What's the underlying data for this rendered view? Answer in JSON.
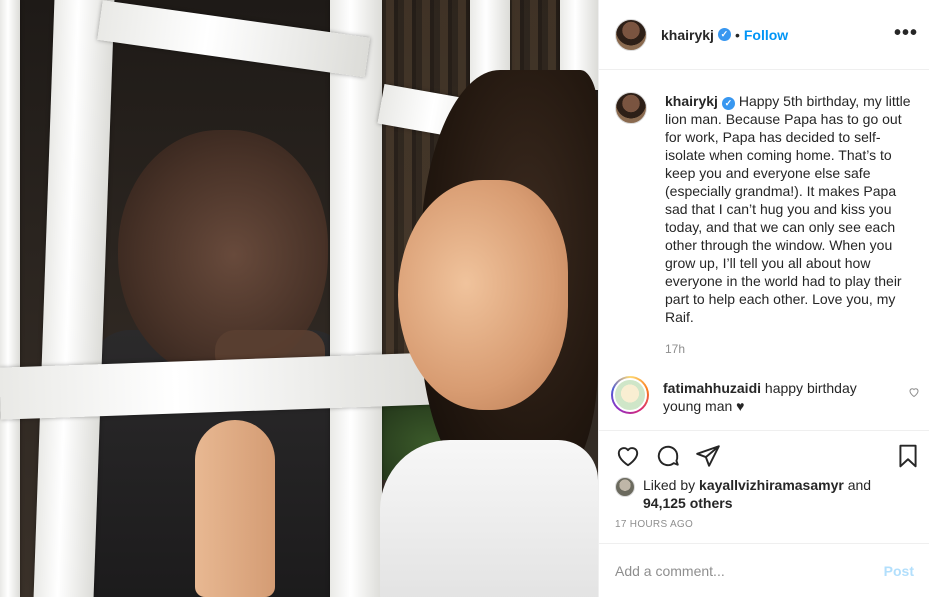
{
  "post": {
    "username": "khairykj",
    "follow_label": "Follow",
    "dot": "•",
    "more": "•••",
    "verified_glyph": "✓",
    "caption_username": "khairykj",
    "caption": "Happy 5th birthday, my little lion man. Because Papa has to go out for work, Papa has decided to self-isolate when coming home. That’s to keep you and everyone else safe (especially grandma!). It makes Papa sad that I can’t hug you and kiss you today, and that we can only see each other through the window. When you grow up, I’ll tell you all about how everyone in the world had to play their part to help each other. Love you, my Raif.",
    "time": "17h"
  },
  "comment": {
    "username": "fatimahhuzaidi",
    "text": "happy birthday young man ♥"
  },
  "likes": {
    "prefix": "Liked by",
    "liker": "kayallvizhiramasamyr",
    "connector": "and",
    "others": "94,125 others"
  },
  "timestamp": "17 HOURS AGO",
  "add_comment": {
    "placeholder": "Add a comment...",
    "post_label": "Post"
  },
  "colors": {
    "link": "#0095f6",
    "verified": "#3897f0",
    "muted": "#8e8e8e",
    "post_disabled": "#b2dffc"
  }
}
